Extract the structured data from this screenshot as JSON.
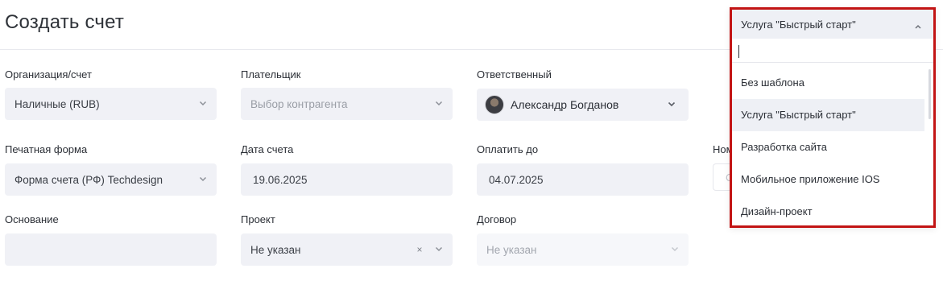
{
  "page": {
    "title": "Создать счет"
  },
  "form": {
    "organization": {
      "label": "Организация/счет",
      "value": "Наличные (RUB)"
    },
    "payer": {
      "label": "Плательщик",
      "placeholder": "Выбор контрагента"
    },
    "responsible": {
      "label": "Ответственный",
      "value": "Александр Богданов"
    },
    "print_form": {
      "label": "Печатная форма",
      "value": "Форма счета (РФ) Techdesign"
    },
    "invoice_date": {
      "label": "Дата счета",
      "value": "19.06.2025"
    },
    "pay_by": {
      "label": "Оплатить до",
      "value": "04.07.2025"
    },
    "number": {
      "label": "Ном",
      "placeholder": "С"
    },
    "basis": {
      "label": "Основание",
      "value": ""
    },
    "project": {
      "label": "Проект",
      "value": "Не указан",
      "clear_icon": "×"
    },
    "contract": {
      "label": "Договор",
      "placeholder": "Не указан"
    }
  },
  "template_dropdown": {
    "selected": "Услуга \"Быстрый старт\"",
    "search_value": "",
    "options": [
      "Без шаблона",
      "Услуга \"Быстрый старт\"",
      "Разработка сайта",
      "Мобильное приложение IOS",
      "Дизайн-проект"
    ],
    "highlighted_index": 1,
    "outline_color": "#c21414"
  },
  "colors": {
    "field_bg": "#f0f1f6",
    "disabled_field_bg": "#f6f7fa",
    "text": "#2b2f36",
    "muted_text": "#a2a6ae"
  }
}
